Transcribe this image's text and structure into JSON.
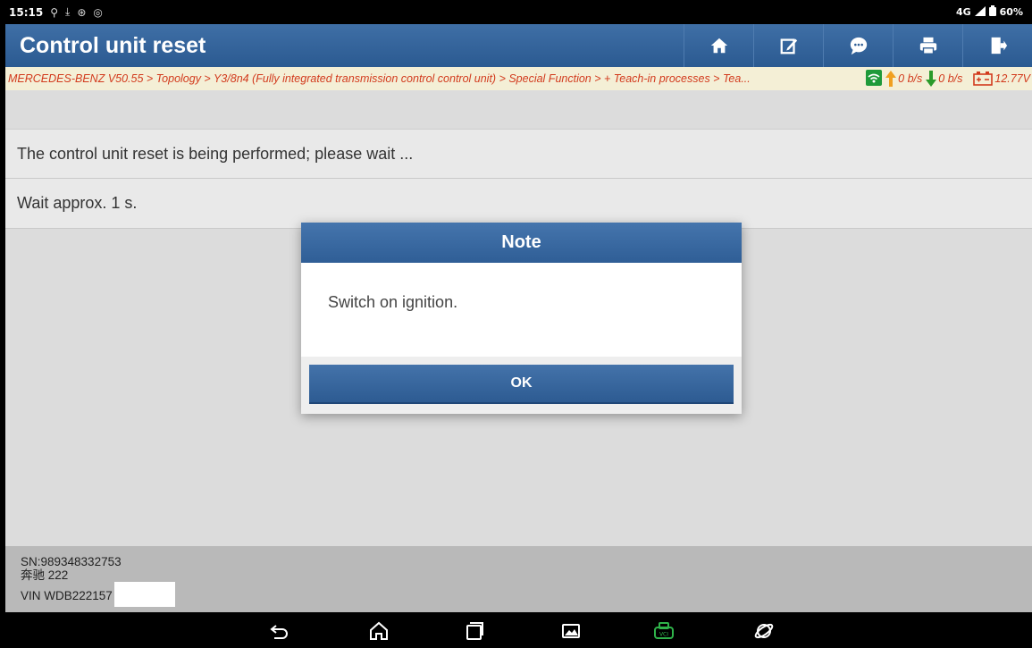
{
  "status": {
    "time": "15:15",
    "icons": [
      "usb-icon",
      "download-icon",
      "accessibility-icon",
      "message-icon"
    ],
    "network": "4G",
    "battery": "60%"
  },
  "header": {
    "title": "Control unit reset",
    "toolbar": [
      "home-icon",
      "edit-icon",
      "chat-icon",
      "print-icon",
      "exit-icon"
    ]
  },
  "breadcrumb": {
    "path": "MERCEDES-BENZ V50.55 > Topology > Y3/8n4 (Fully integrated transmission control control unit) > Special Function > + Teach-in processes > Tea...",
    "upload": "0 b/s",
    "download": "0 b/s",
    "voltage": "12.77V"
  },
  "rows": [
    "The control unit reset is being performed; please wait ...",
    "Wait approx. 1 s."
  ],
  "dialog": {
    "title": "Note",
    "message": "Switch on ignition.",
    "ok_label": "OK"
  },
  "footer": {
    "sn": "SN:989348332753",
    "model": "奔驰 222",
    "vin": "VIN WDB222157"
  },
  "colors": {
    "header_blue": "#2b5a91",
    "crumb_red": "#d23a1d",
    "crumb_bg": "#f4efd6",
    "vci_green": "#2fb34a"
  }
}
